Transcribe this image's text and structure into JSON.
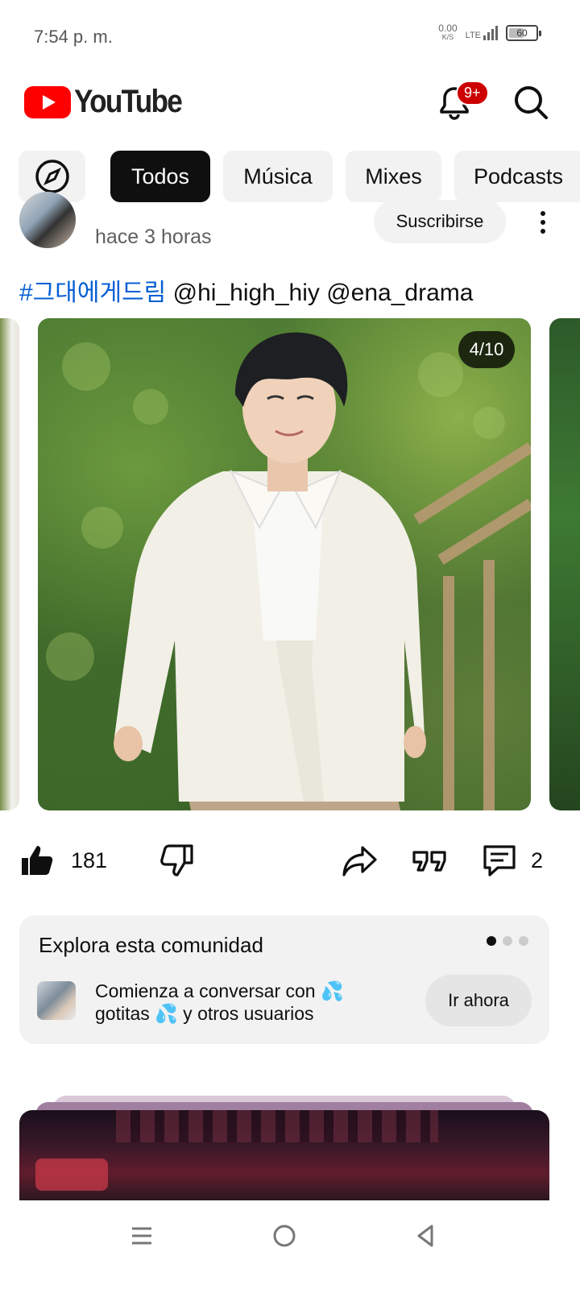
{
  "status_bar": {
    "time": "7:54 p. m.",
    "net_speed": "0.00",
    "net_unit": "K/S",
    "network": "LTE",
    "battery": "60"
  },
  "header": {
    "app_name": "YouTube",
    "notification_badge": "9+",
    "icons": [
      "bell-icon",
      "search-icon"
    ]
  },
  "chips": [
    {
      "label": "",
      "icon": "explore-icon"
    },
    {
      "label": "Todos",
      "active": true
    },
    {
      "label": "Música"
    },
    {
      "label": "Mixes"
    },
    {
      "label": "Podcasts"
    }
  ],
  "post": {
    "time": "hace 3 horas",
    "subscribe_label": "Suscribirse",
    "hashtag": "#그대에게드림",
    "mentions": "@hi_high_hiy @ena_drama",
    "photo_counter": "4/10",
    "likes": "181",
    "comments": "2"
  },
  "community": {
    "title": "Explora esta comunidad",
    "message": "Comienza a conversar con 💦 gotitas 💦 y otros usuarios",
    "button": "Ir ahora"
  },
  "colors": {
    "brand": "#ff0000",
    "link": "#065fd4",
    "badge": "#cc0000",
    "chip_active": "#0f0f0f",
    "chip_bg": "#f2f2f2"
  }
}
